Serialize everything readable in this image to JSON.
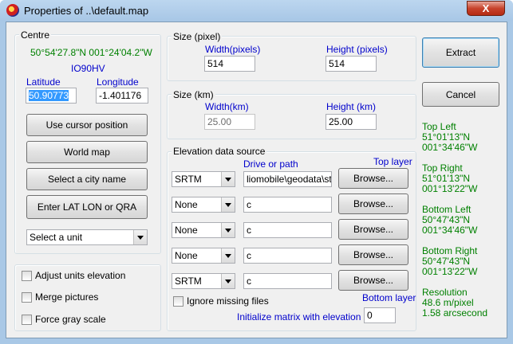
{
  "window": {
    "title": "Properties of ..\\default.map",
    "close_label": "X"
  },
  "centre": {
    "label": "Centre",
    "coords": "50°54'27.8\"N 001°24'04.2\"W",
    "locator": "IO90HV",
    "latitude_label": "Latitude",
    "longitude_label": "Longitude",
    "latitude": "50.90773",
    "longitude": "-1.401176",
    "buttons": [
      "Use cursor position",
      "World map",
      "Select a city name",
      "Enter LAT LON or QRA"
    ],
    "unit_select": "Select a unit"
  },
  "options": {
    "adjust_units": "Adjust units elevation",
    "merge_pictures": "Merge pictures",
    "force_gray": "Force gray scale"
  },
  "size_pixel": {
    "label": "Size (pixel)",
    "width_label": "Width(pixels)",
    "height_label": "Height (pixels)",
    "width": "514",
    "height": "514"
  },
  "size_km": {
    "label": "Size (km)",
    "width_label": "Width(km)",
    "height_label": "Height (km)",
    "width": "25.00",
    "height": "25.00"
  },
  "elevation": {
    "label": "Elevation data source",
    "drive_label": "Drive or path",
    "top_layer": "Top layer",
    "bottom_layer": "Bottom layer",
    "browse": "Browse...",
    "rows": [
      {
        "source": "SRTM",
        "path": "liomobile\\geodata\\strm"
      },
      {
        "source": "None",
        "path": "c"
      },
      {
        "source": "None",
        "path": "c"
      },
      {
        "source": "None",
        "path": "c"
      },
      {
        "source": "SRTM",
        "path": "c"
      }
    ],
    "ignore_missing": "Ignore missing files",
    "init_label": "Initialize matrix with elevation (m)",
    "init_value": "0"
  },
  "actions": {
    "extract": "Extract",
    "cancel": "Cancel"
  },
  "corners": {
    "top_left_label": "Top Left",
    "top_left_lat": "51°01'13\"N",
    "top_left_lon": "001°34'46\"W",
    "top_right_label": "Top Right",
    "top_right_lat": "51°01'13\"N",
    "top_right_lon": "001°13'22\"W",
    "bottom_left_label": "Bottom Left",
    "bottom_left_lat": "50°47'43\"N",
    "bottom_left_lon": "001°34'46\"W",
    "bottom_right_label": "Bottom Right",
    "bottom_right_lat": "50°47'43\"N",
    "bottom_right_lon": "001°13'22\"W",
    "resolution_label": "Resolution",
    "resolution_m": "48.6 m/pixel",
    "resolution_arc": "1.58 arcsecond"
  }
}
